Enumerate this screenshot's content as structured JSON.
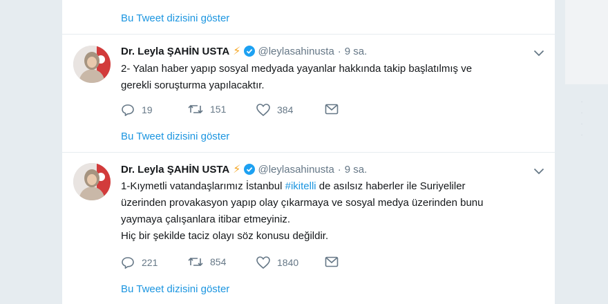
{
  "show_thread_label": "Bu Tweet dizisini göster",
  "tweets": [
    {
      "author_name": "Dr. Leyla ŞAHİN USTA",
      "handle": "@leylasahinusta",
      "time": "9 sa.",
      "text_lines": [
        "2- Yalan haber yapıp sosyal medyada yayanlar hakkında takip başlatılmış ve",
        "gerekli soruşturma yapılacaktır."
      ],
      "replies": "19",
      "retweets": "151",
      "likes": "384"
    },
    {
      "author_name": "Dr. Leyla ŞAHİN USTA",
      "handle": "@leylasahinusta",
      "time": "9 sa.",
      "text_line1_pre": "1-Kıymetli vatandaşlarımız İstanbul ",
      "hashtag": "#ikitelli",
      "text_line1_post": " de asılsız haberler ile Suriyeliler",
      "text_lines_rest": [
        "üzerinden provakasyon yapıp olay çıkarmaya ve sosyal medya üzerinden bunu",
        "yaymaya çalışanlara itibar etmeyiniz.",
        "Hiç bir şekilde taciz olayı söz konusu değildir."
      ],
      "replies": "221",
      "retweets": "854",
      "likes": "1840"
    }
  ],
  "icons": {
    "reply": "reply-icon",
    "retweet": "retweet-icon",
    "like": "heart-icon",
    "dm": "envelope-icon",
    "verified": "verified-badge-icon",
    "bolt": "lightning-emoji",
    "caret": "chevron-down-icon"
  },
  "colors": {
    "link": "#1b95e0",
    "text": "#14171a",
    "secondary": "#657786",
    "verified": "#1da1f2",
    "bolt": "#f5a623"
  }
}
